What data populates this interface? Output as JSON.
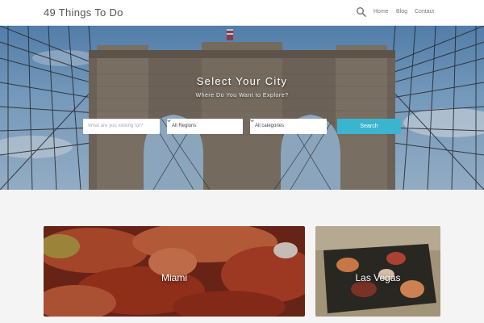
{
  "header": {
    "logo": "49 Things To Do",
    "search_icon": "search-icon",
    "nav": [
      "Home",
      "Blog",
      "Contact"
    ]
  },
  "hero": {
    "title": "Select Your City",
    "subtitle": "Where Do You Want to Explore?",
    "search": {
      "keyword_placeholder": "What are you looking for?",
      "region_selected": "All Regions",
      "category_selected": "All categories",
      "button_label": "Search"
    },
    "colors": {
      "accent": "#3ab4cf",
      "sky": "#7aa8d2",
      "stone": "#7b6f62"
    }
  },
  "cities": [
    {
      "name": "Miami"
    },
    {
      "name": "Las Vegas"
    }
  ]
}
